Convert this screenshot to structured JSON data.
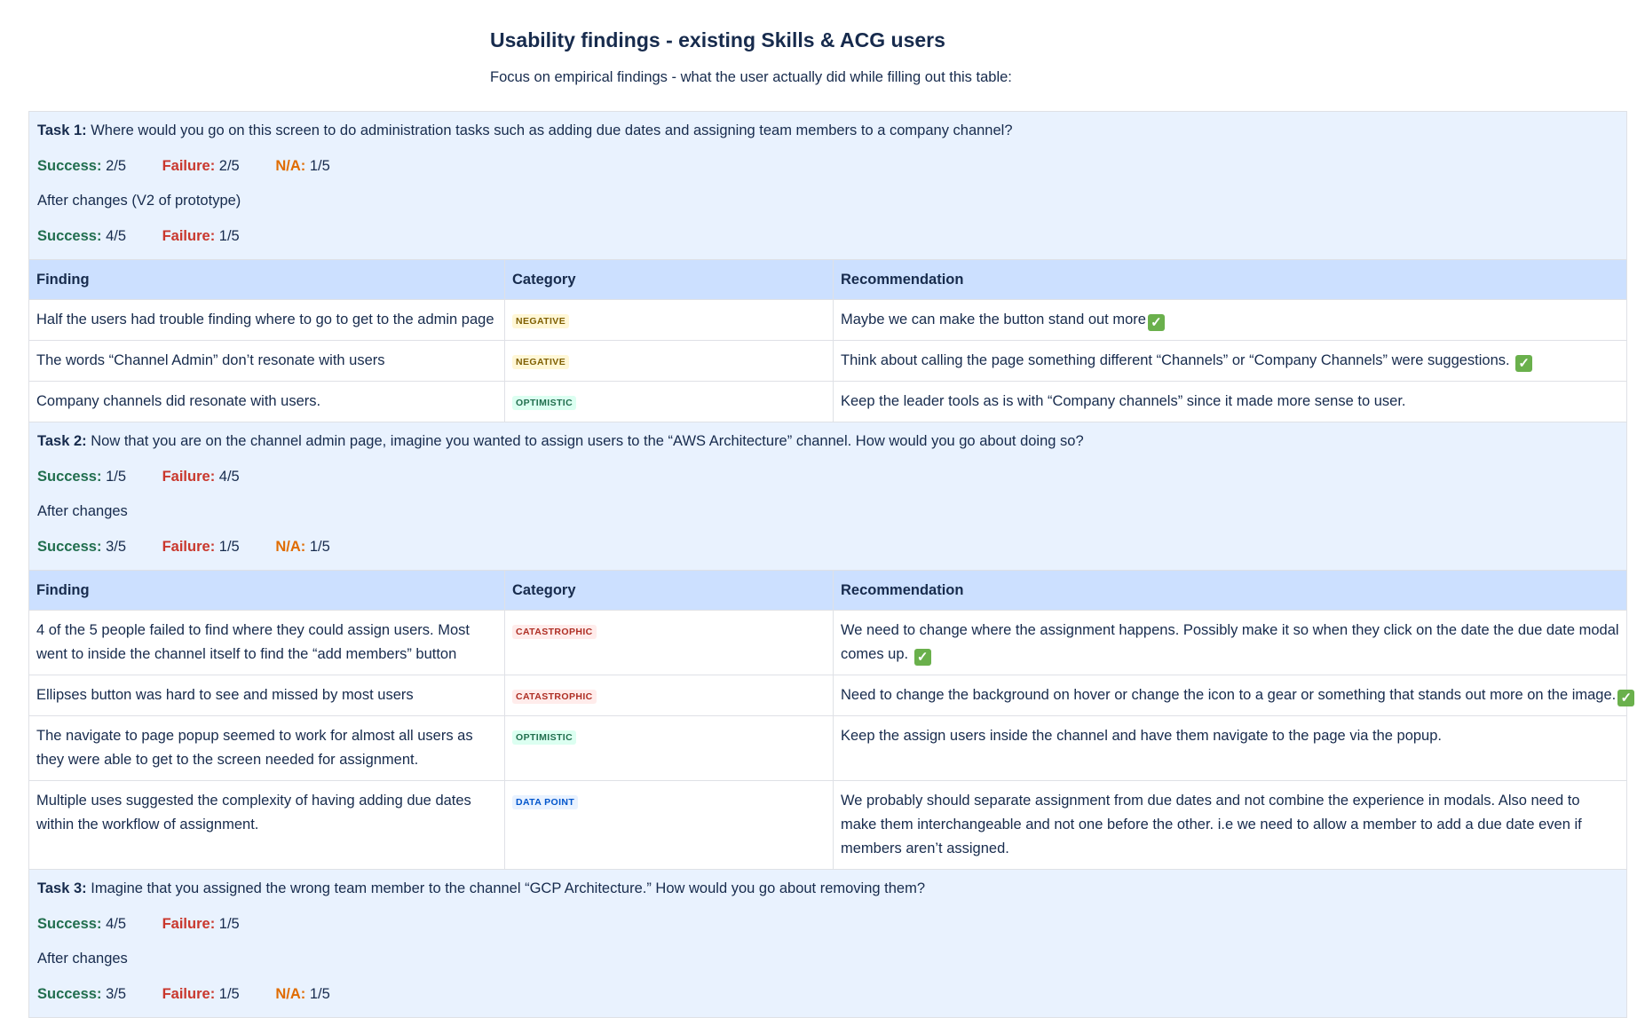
{
  "doc": {
    "title": "Usability findings - existing Skills & ACG users",
    "subtitle": "Focus on empirical findings - what the user actually did while filling out this table:"
  },
  "labels": {
    "success": "Success:",
    "failure": "Failure:",
    "na": "N/A:",
    "finding": "Finding",
    "category": "Category",
    "recommendation": "Recommendation",
    "check_icon": "✓"
  },
  "tasks": [
    {
      "label": "Task 1:",
      "question": "Where would you go on this screen to do administration tasks such as adding due dates and assigning team members to a company channel?",
      "before": {
        "success": "2/5",
        "failure": "2/5",
        "na": "1/5"
      },
      "after_label": "After changes (V2 of prototype)",
      "after": {
        "success": "4/5",
        "failure": "1/5"
      },
      "findings": [
        {
          "finding": "Half the users had trouble finding where to go to get to the admin page",
          "category": "NEGATIVE",
          "recommendation": "Maybe we can make the button stand out more",
          "check": true
        },
        {
          "finding": "The words “Channel Admin” don’t resonate with users",
          "category": "NEGATIVE",
          "recommendation": "Think about calling the page something different “Channels” or “Company Channels” were suggestions. ",
          "check": true
        },
        {
          "finding": "Company channels did resonate with users.",
          "category": "OPTIMISTIC",
          "recommendation": "Keep the leader tools as is with “Company channels” since it made more sense to user.",
          "check": false
        }
      ]
    },
    {
      "label": "Task 2:",
      "question": "Now that you are on the channel admin page, imagine you wanted to assign users to the “AWS Architecture” channel. How would you go about doing so?",
      "before": {
        "success": "1/5",
        "failure": "4/5"
      },
      "after_label": "After changes",
      "after": {
        "success": "3/5",
        "failure": "1/5",
        "na": "1/5"
      },
      "findings": [
        {
          "finding": "4 of the 5 people failed to find where they could assign users. Most went to inside the channel itself to find the “add members” button",
          "category": "CATASTROPHIC",
          "recommendation": "We need to change where the assignment happens. Possibly make it so when they click on the date the due date modal comes up. ",
          "check": true
        },
        {
          "finding": "Ellipses button was hard to see and missed by most users",
          "category": "CATASTROPHIC",
          "recommendation": "Need to change the background on hover or change the icon to a gear or something that stands out more on the image.",
          "check": true
        },
        {
          "finding": "The navigate to page popup seemed to work for almost all users as they were able to get to the screen needed for assignment.",
          "category": "OPTIMISTIC",
          "recommendation": "Keep the assign users inside the channel and have them navigate to the page via the popup.",
          "check": false
        },
        {
          "finding": "Multiple uses suggested the complexity of having adding due dates within the workflow of assignment.",
          "category": "DATA POINT",
          "recommendation": "We probably should separate assignment from due dates and not combine the experience in modals. Also need to make them interchangeable and not one before the other. i.e we need to allow a member to add a due date even if members aren’t assigned.",
          "check": false
        }
      ]
    },
    {
      "label": "Task 3:",
      "question": "Imagine that you assigned the wrong team member to the channel “GCP Architecture.” How would you go about removing them?",
      "before": {
        "success": "4/5",
        "failure": "1/5"
      },
      "after_label": "After changes",
      "after": {
        "success": "3/5",
        "failure": "1/5",
        "na": "1/5"
      },
      "findings": []
    }
  ],
  "colors": {
    "task_bg": "#e9f2fe",
    "header_bg": "#cce0ff",
    "success": "#216e4e",
    "failure": "#c9372c",
    "na": "#e06c00"
  }
}
